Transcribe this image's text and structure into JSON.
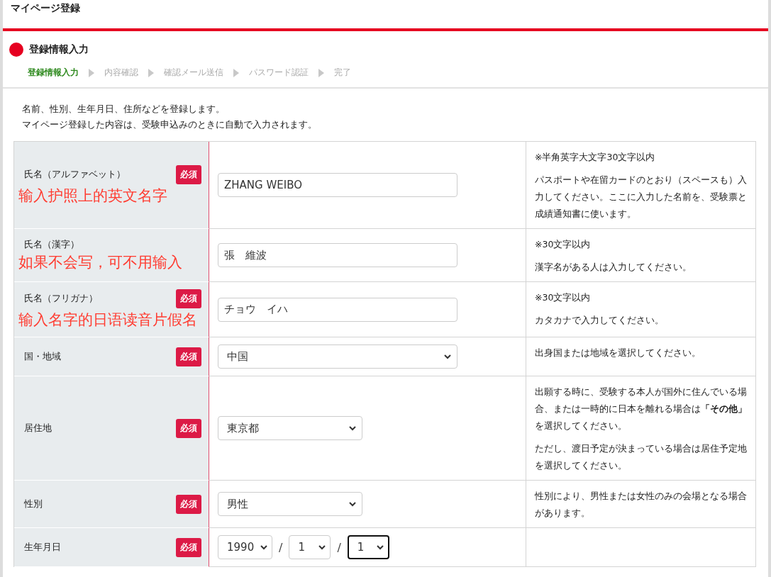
{
  "header": {
    "title": "マイページ登録"
  },
  "section": {
    "title": "登録情報入力"
  },
  "steps": [
    {
      "label": "登録情報入力",
      "selected": true
    },
    {
      "label": "内容確認",
      "selected": false
    },
    {
      "label": "確認メール送信",
      "selected": false
    },
    {
      "label": "パスワード認証",
      "selected": false
    },
    {
      "label": "完了",
      "selected": false
    }
  ],
  "intro": [
    "名前、性別、生年月日、住所などを登録します。",
    "マイページ登録した内容は、受験申込みのときに自動で入力されます。"
  ],
  "rows": [
    {
      "label": "氏名（アルファベット）",
      "badge": "必須",
      "annotation": "输入护照上的英文名字",
      "kind": "text",
      "value": "ZHANG WEIBO",
      "notes": [
        "※半角英字大文字30文字以内",
        "パスポートや在留カードのとおり（スペースも）入力してください。ここに入力した名前を、受験票と成績通知書に使います。"
      ]
    },
    {
      "label": "氏名（漢字）",
      "annotation": "如果不会写，可不用输入",
      "kind": "text",
      "value": "張　維波",
      "notes": [
        "※30文字以内",
        "漢字名がある人は入力してください。"
      ]
    },
    {
      "label": "氏名（フリガナ）",
      "badge": "必須",
      "annotation": "输入名字的日语读音片假名",
      "kind": "text",
      "value": "チョウ　イハ",
      "notes": [
        "※30文字以内",
        "カタカナで入力してください。"
      ]
    },
    {
      "label": "国・地域",
      "badge": "必須",
      "kind": "select",
      "value": "中国",
      "notes": [
        "出身国または地域を選択してください。"
      ]
    },
    {
      "label": "居住地",
      "badge": "必須",
      "kind": "select",
      "value": "東京都",
      "notes": [
        "出願する時に、受験する本人が国外に住んでいる場合、または一時的に日本を離れる場合は**「その他」**を選択してください。",
        "ただし、渡日予定が決まっている場合は居住予定地を選択してください。"
      ]
    },
    {
      "label": "性別",
      "badge": "必須",
      "kind": "select",
      "value": "男性",
      "notes": [
        "性別により、男性または女性のみの会場となる場合があります。"
      ]
    },
    {
      "label": "生年月日",
      "badge": "必須",
      "kind": "date",
      "parts": [
        {
          "value": "1990",
          "focused": false
        },
        {
          "value": "1",
          "focused": false
        },
        {
          "value": "1",
          "focused": true
        }
      ],
      "separators": [
        "/",
        "/"
      ]
    }
  ]
}
